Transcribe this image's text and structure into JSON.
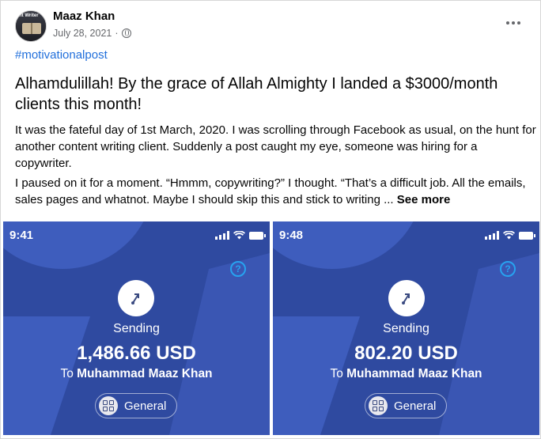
{
  "post": {
    "author": "Maaz Khan",
    "date": "July 28, 2021",
    "date_separator": "·",
    "privacy_icon": "globe-icon",
    "more_icon": "more-horizontal-icon",
    "avatar_text": "nt Writer",
    "hashtag": "#motivationalpost",
    "headline": "Alhamdulillah! By the grace of Allah Almighty I landed a $3000/month clients this month!",
    "paragraph1": "It was the fateful day of 1st March, 2020. I was scrolling through Facebook as usual, on the hunt for another content writing client. Suddenly a post caught my eye, someone was hiring for a copywriter.",
    "paragraph2": "I paused on it for a moment. “Hmmm, copywriting?” I thought. “That’s a difficult job. All the emails, sales pages and whatnot. Maybe I should skip this and stick to writing ...",
    "see_more": "See more"
  },
  "photos": [
    {
      "time": "9:41",
      "sending_label": "Sending",
      "amount": "1,486.66 USD",
      "to_prefix": "To ",
      "recipient": "Muhammad Maaz Khan",
      "category": "General",
      "help_glyph": "?"
    },
    {
      "time": "9:48",
      "sending_label": "Sending",
      "amount": "802.20 USD",
      "to_prefix": "To ",
      "recipient": "Muhammad Maaz Khan",
      "category": "General",
      "help_glyph": "?"
    }
  ],
  "colors": {
    "link": "#216fdb",
    "photo_bg": "#2f4aa0",
    "photo_accent": "#3e5dbd",
    "help": "#27a3f0"
  }
}
